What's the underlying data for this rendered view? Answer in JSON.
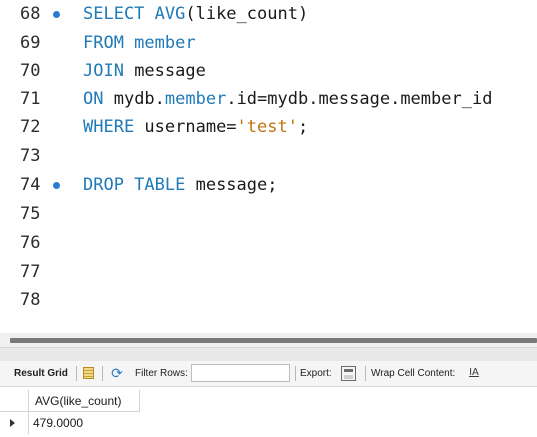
{
  "editor": {
    "lines": [
      {
        "no": "68",
        "marker": true,
        "tokens": [
          {
            "t": "SELECT AVG",
            "k": "kw"
          },
          {
            "t": "(like_count)",
            "k": "plain"
          }
        ]
      },
      {
        "no": "69",
        "marker": false,
        "tokens": [
          {
            "t": "FROM member",
            "k": "kw"
          }
        ]
      },
      {
        "no": "70",
        "marker": false,
        "tokens": [
          {
            "t": "JOIN",
            "k": "kw"
          },
          {
            "t": " message",
            "k": "plain"
          }
        ]
      },
      {
        "no": "71",
        "marker": false,
        "tokens": [
          {
            "t": "ON",
            "k": "kw"
          },
          {
            "t": " mydb.",
            "k": "plain"
          },
          {
            "t": "member",
            "k": "kw"
          },
          {
            "t": ".id=mydb.message.member_id",
            "k": "plain"
          }
        ]
      },
      {
        "no": "72",
        "marker": false,
        "tokens": [
          {
            "t": "WHERE",
            "k": "kw"
          },
          {
            "t": " username=",
            "k": "plain"
          },
          {
            "t": "'test'",
            "k": "str"
          },
          {
            "t": ";",
            "k": "plain"
          }
        ]
      },
      {
        "no": "73",
        "marker": false,
        "tokens": []
      },
      {
        "no": "74",
        "marker": true,
        "tokens": [
          {
            "t": "DROP TABLE",
            "k": "kw"
          },
          {
            "t": " message;",
            "k": "plain"
          }
        ]
      },
      {
        "no": "75",
        "marker": false,
        "tokens": []
      },
      {
        "no": "76",
        "marker": false,
        "tokens": []
      },
      {
        "no": "77",
        "marker": false,
        "tokens": []
      },
      {
        "no": "78",
        "marker": false,
        "tokens": []
      }
    ]
  },
  "toolbar": {
    "result_grid_label": "Result Grid",
    "filter_label": "Filter Rows:",
    "filter_value": "",
    "export_label": "Export:",
    "wrap_label": "Wrap Cell Content:",
    "wrap_icon_glyph": "IA",
    "refresh_icon_glyph": "⟳"
  },
  "result": {
    "columns": [
      "AVG(like_count)"
    ],
    "rows": [
      [
        "479.0000"
      ]
    ]
  },
  "colors": {
    "keyword": "#1f7ab8",
    "string": "#c4720d",
    "statement_marker": "#2b7bd3"
  }
}
